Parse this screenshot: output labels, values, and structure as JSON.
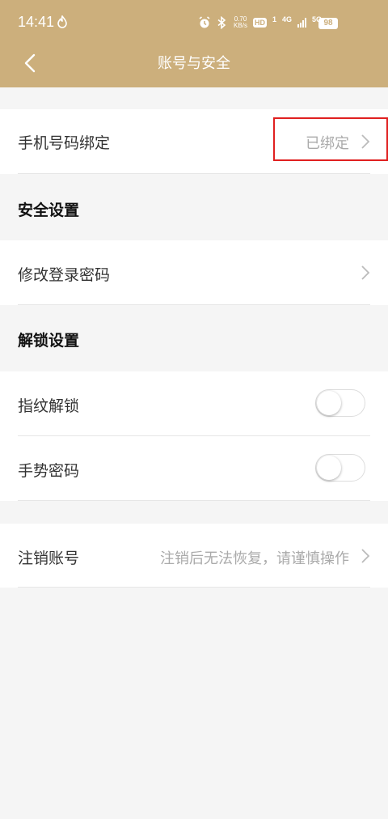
{
  "status_bar": {
    "time": "14:41",
    "speed_value": "0.70",
    "speed_unit": "KB/s",
    "hd_label": "HD",
    "sim1_label": "1",
    "net1_label": "4G",
    "net2_label": "5G",
    "battery_level": "98"
  },
  "header": {
    "title": "账号与安全",
    "back_icon": "chevron-left-icon"
  },
  "phone_binding": {
    "label": "手机号码绑定",
    "value": "已绑定"
  },
  "security_section": {
    "title": "安全设置",
    "change_password_label": "修改登录密码"
  },
  "unlock_section": {
    "title": "解锁设置",
    "fingerprint_label": "指纹解锁",
    "fingerprint_enabled": false,
    "gesture_label": "手势密码",
    "gesture_enabled": false
  },
  "deactivate": {
    "label": "注销账号",
    "hint": "注销后无法恢复，请谨慎操作"
  },
  "colors": {
    "header_bg": "#ccaf7c",
    "highlight_border": "#e02020",
    "page_bg": "#f5f5f5"
  }
}
